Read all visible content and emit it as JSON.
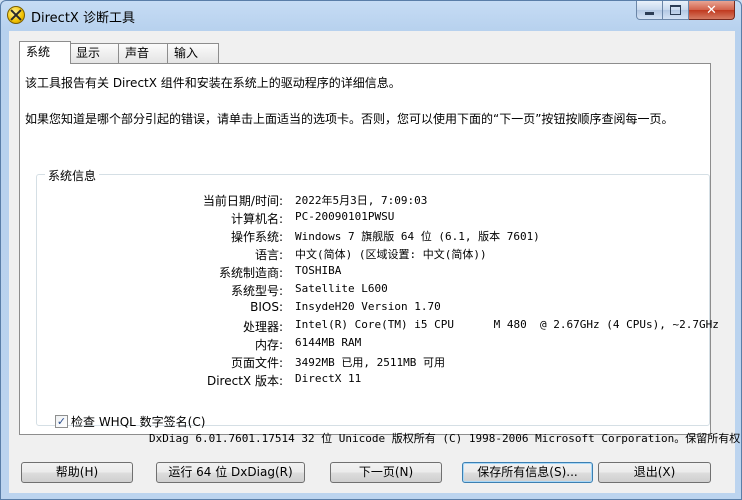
{
  "window": {
    "title": "DirectX 诊断工具"
  },
  "tabs": [
    {
      "label": "系统"
    },
    {
      "label": "显示"
    },
    {
      "label": "声音"
    },
    {
      "label": "输入"
    }
  ],
  "intro": {
    "line1": "该工具报告有关 DirectX 组件和安装在系统上的驱动程序的详细信息。",
    "line2": "如果您知道是哪个部分引起的错误，请单击上面适当的选项卡。否则，您可以使用下面的“下一页”按钮按顺序查阅每一页。"
  },
  "system_info": {
    "group_title": "系统信息",
    "rows": [
      {
        "label": "当前日期/时间:",
        "value": "2022年5月3日, 7:09:03"
      },
      {
        "label": "计算机名:",
        "value": "PC-20090101PWSU"
      },
      {
        "label": "操作系统:",
        "value": "Windows 7 旗舰版 64 位 (6.1, 版本 7601)"
      },
      {
        "label": "语言:",
        "value": "中文(简体) (区域设置: 中文(简体))"
      },
      {
        "label": "系统制造商:",
        "value": "TOSHIBA"
      },
      {
        "label": "系统型号:",
        "value": "Satellite L600"
      },
      {
        "label": "BIOS:",
        "value": "InsydeH20 Version 1.70"
      },
      {
        "label": "处理器:",
        "value": "Intel(R) Core(TM) i5 CPU      M 480  @ 2.67GHz (4 CPUs), ~2.7GHz"
      },
      {
        "label": "内存:",
        "value": "6144MB RAM"
      },
      {
        "label": "页面文件:",
        "value": "3492MB 已用, 2511MB 可用"
      },
      {
        "label": "DirectX 版本:",
        "value": "DirectX 11"
      }
    ],
    "whql_label": "检查 WHQL 数字签名(C)",
    "whql_checked": "✓"
  },
  "footer": {
    "copyright": "DxDiag 6.01.7601.17514 32 位 Unicode 版权所有 (C) 1998-2006 Microsoft Corporation。保留所有权"
  },
  "buttons": {
    "help": "帮助(H)",
    "run64": "运行 64 位 DxDiag(R)",
    "next": "下一页(N)",
    "save": "保存所有信息(S)...",
    "exit": "退出(X)"
  },
  "caption": {
    "close": "✕"
  }
}
